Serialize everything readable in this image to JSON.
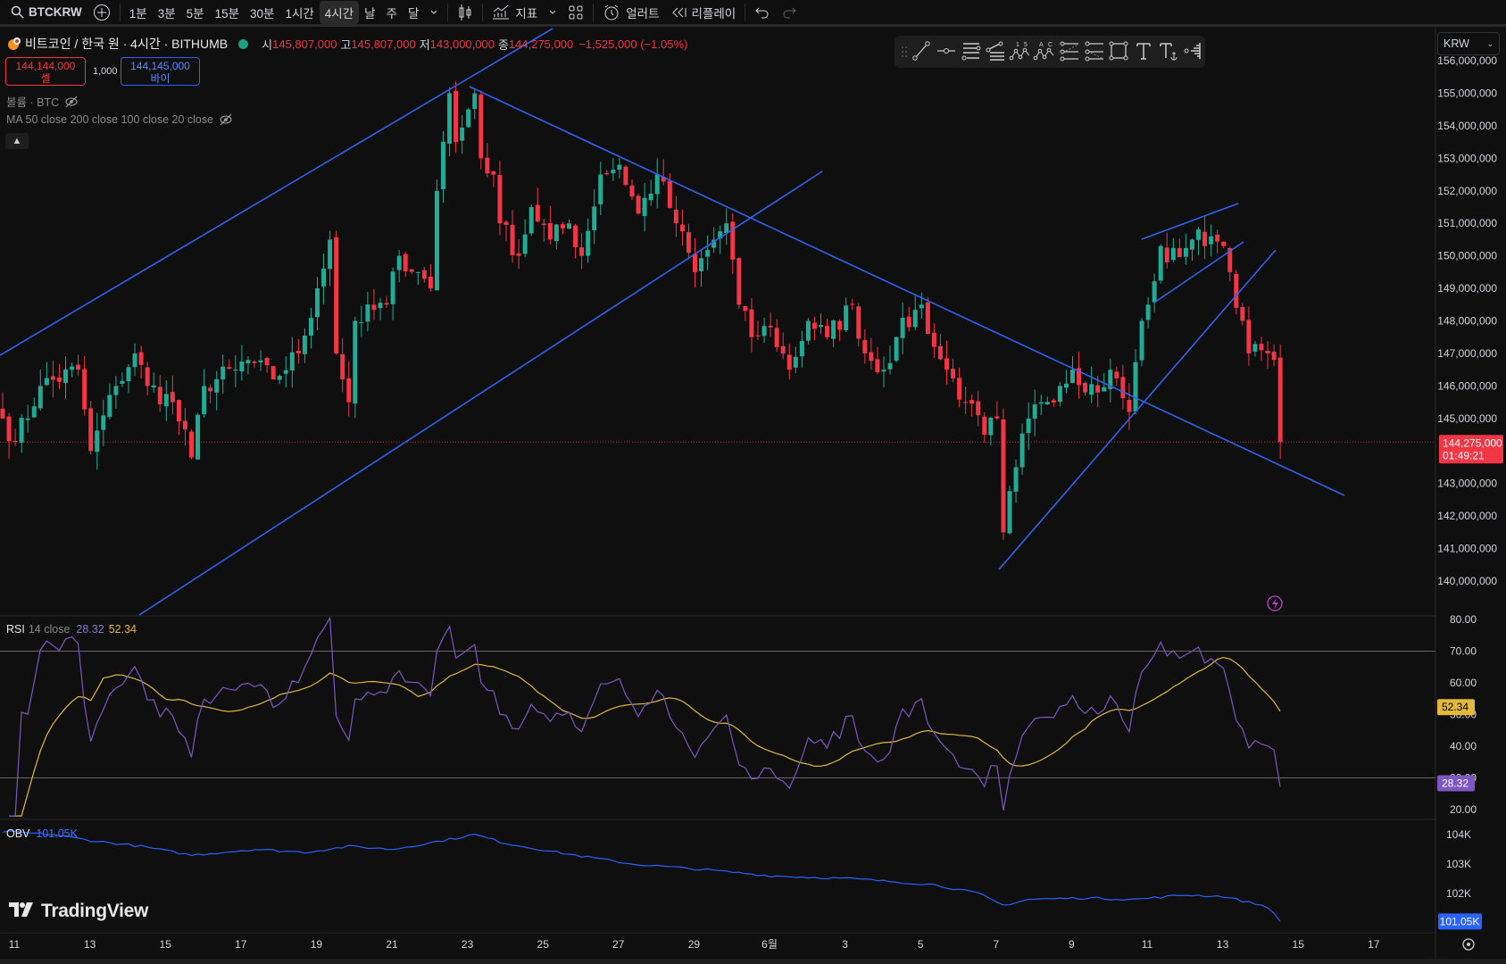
{
  "topbar": {
    "symbol": "BTCKRW",
    "intervals": [
      "1분",
      "3분",
      "5분",
      "15분",
      "30분",
      "1시간",
      "4시간",
      "날",
      "주",
      "달"
    ],
    "active_interval": "4시간",
    "indicators_label": "지표",
    "alert_label": "얼러트",
    "replay_label": "리플레이"
  },
  "legend": {
    "title": "비트코인 / 한국 원 · 4시간 · BITHUMB",
    "open_label": "시",
    "open": "145,807,000",
    "high_label": "고",
    "high": "145,807,000",
    "low_label": "저",
    "low": "143,000,000",
    "close_label": "종",
    "close": "144,275,000",
    "change": "−1,525,000 (−1.05%)"
  },
  "trade": {
    "sell_price": "144,144,000",
    "sell_label": "셀",
    "quantity": "1,000",
    "buy_price": "144,145,000",
    "buy_label": "바이"
  },
  "indicators": {
    "volume": "볼륨 · BTC",
    "ma": "MA 50 close 200 close 100 close 20 close"
  },
  "currency": "KRW",
  "price_axis": [
    "156,000,000",
    "155,000,000",
    "154,000,000",
    "153,000,000",
    "152,000,000",
    "151,000,000",
    "150,000,000",
    "149,000,000",
    "148,000,000",
    "147,000,000",
    "146,000,000",
    "145,000,000",
    "143,000,000",
    "142,000,000",
    "141,000,000",
    "140,000,000"
  ],
  "current_price": {
    "value": "144,275,000",
    "countdown": "01:49:21",
    "price": 144.275
  },
  "rsi": {
    "name": "RSI",
    "params": "14 close",
    "value": "28.32",
    "ma_value": "52.34",
    "axis": [
      "80.00",
      "70.00",
      "60.00",
      "50.00",
      "40.00",
      "30.00",
      "20.00"
    ],
    "upper_band": 70,
    "lower_band": 30
  },
  "obv": {
    "name": "OBV",
    "value": "101.05K",
    "axis": [
      "104K",
      "103K",
      "102K"
    ],
    "keypoints": [
      [
        0,
        104.1
      ],
      [
        8,
        104.0
      ],
      [
        14,
        103.8
      ],
      [
        22,
        103.6
      ],
      [
        30,
        103.3
      ],
      [
        40,
        103.5
      ],
      [
        48,
        103.4
      ],
      [
        55,
        103.6
      ],
      [
        62,
        103.5
      ],
      [
        70,
        103.8
      ],
      [
        75,
        104.0
      ],
      [
        80,
        103.7
      ],
      [
        88,
        103.4
      ],
      [
        100,
        103.0
      ],
      [
        112,
        102.8
      ],
      [
        122,
        102.6
      ],
      [
        135,
        102.5
      ],
      [
        148,
        102.3
      ],
      [
        155,
        102.0
      ],
      [
        159,
        101.6
      ],
      [
        163,
        101.8
      ],
      [
        172,
        101.85
      ],
      [
        180,
        101.8
      ],
      [
        188,
        101.95
      ],
      [
        194,
        101.9
      ],
      [
        198,
        101.7
      ],
      [
        201,
        101.55
      ],
      [
        203,
        101.05
      ]
    ]
  },
  "time_axis": [
    "11",
    "13",
    "15",
    "17",
    "19",
    "21",
    "23",
    "25",
    "27",
    "29",
    "6월",
    "3",
    "5",
    "7",
    "9",
    "11",
    "13",
    "15",
    "17"
  ],
  "brand": "TradingView",
  "colors": {
    "up": "#22ab94",
    "down": "#f23645",
    "drawing": "#2f63f0",
    "rsi": "#7e57c2",
    "rsi_ma": "#e2b93b",
    "obv": "#2962ff"
  },
  "chart_data": {
    "type": "candlestick",
    "unit": "million KRW",
    "ylim": [
      140,
      156
    ],
    "close_keypoints": [
      [
        0,
        145.0
      ],
      [
        2,
        144.3
      ],
      [
        6,
        146.0
      ],
      [
        12,
        146.5
      ],
      [
        14,
        144.0
      ],
      [
        18,
        146.0
      ],
      [
        21,
        147.0
      ],
      [
        23,
        146.0
      ],
      [
        27,
        145.5
      ],
      [
        30,
        143.8
      ],
      [
        32,
        146.0
      ],
      [
        37,
        146.5
      ],
      [
        39,
        146.8
      ],
      [
        43,
        146.2
      ],
      [
        47,
        147.0
      ],
      [
        50,
        149.0
      ],
      [
        52,
        150.5
      ],
      [
        53,
        147.0
      ],
      [
        55,
        145.5
      ],
      [
        56,
        148.0
      ],
      [
        61,
        148.5
      ],
      [
        63,
        150.0
      ],
      [
        66,
        149.5
      ],
      [
        68,
        149.0
      ],
      [
        69,
        152.0
      ],
      [
        71,
        155.0
      ],
      [
        72,
        153.5
      ],
      [
        74,
        154.5
      ],
      [
        75,
        155.0
      ],
      [
        76,
        153.0
      ],
      [
        78,
        152.5
      ],
      [
        79,
        151.0
      ],
      [
        82,
        150.0
      ],
      [
        84,
        151.5
      ],
      [
        87,
        150.5
      ],
      [
        90,
        151.0
      ],
      [
        92,
        150.0
      ],
      [
        95,
        152.5
      ],
      [
        98,
        152.8
      ],
      [
        101,
        151.3
      ],
      [
        104,
        152.5
      ],
      [
        107,
        151.0
      ],
      [
        110,
        149.5
      ],
      [
        113,
        150.5
      ],
      [
        115,
        151.0
      ],
      [
        117,
        148.5
      ],
      [
        119,
        147.5
      ],
      [
        122,
        147.8
      ],
      [
        125,
        146.5
      ],
      [
        128,
        148.0
      ],
      [
        131,
        147.5
      ],
      [
        135,
        148.5
      ],
      [
        137,
        147.0
      ],
      [
        140,
        146.5
      ],
      [
        142,
        147.5
      ],
      [
        146,
        148.5
      ],
      [
        148,
        147.2
      ],
      [
        150,
        146.5
      ],
      [
        153,
        145.5
      ],
      [
        156,
        144.5
      ],
      [
        158,
        145.0
      ],
      [
        159,
        141.5
      ],
      [
        161,
        143.5
      ],
      [
        163,
        145.0
      ],
      [
        165,
        145.5
      ],
      [
        168,
        146.0
      ],
      [
        170,
        146.5
      ],
      [
        174,
        145.8
      ],
      [
        176,
        146.5
      ],
      [
        179,
        145.2
      ],
      [
        181,
        148.0
      ],
      [
        182,
        148.5
      ],
      [
        184,
        150.3
      ],
      [
        185,
        149.8
      ],
      [
        189,
        150.5
      ],
      [
        192,
        150.6
      ],
      [
        194,
        150.3
      ],
      [
        195,
        149.5
      ],
      [
        197,
        148.0
      ],
      [
        198,
        147.0
      ],
      [
        201,
        147.0
      ],
      [
        202,
        146.8
      ],
      [
        203,
        144.275
      ]
    ]
  }
}
